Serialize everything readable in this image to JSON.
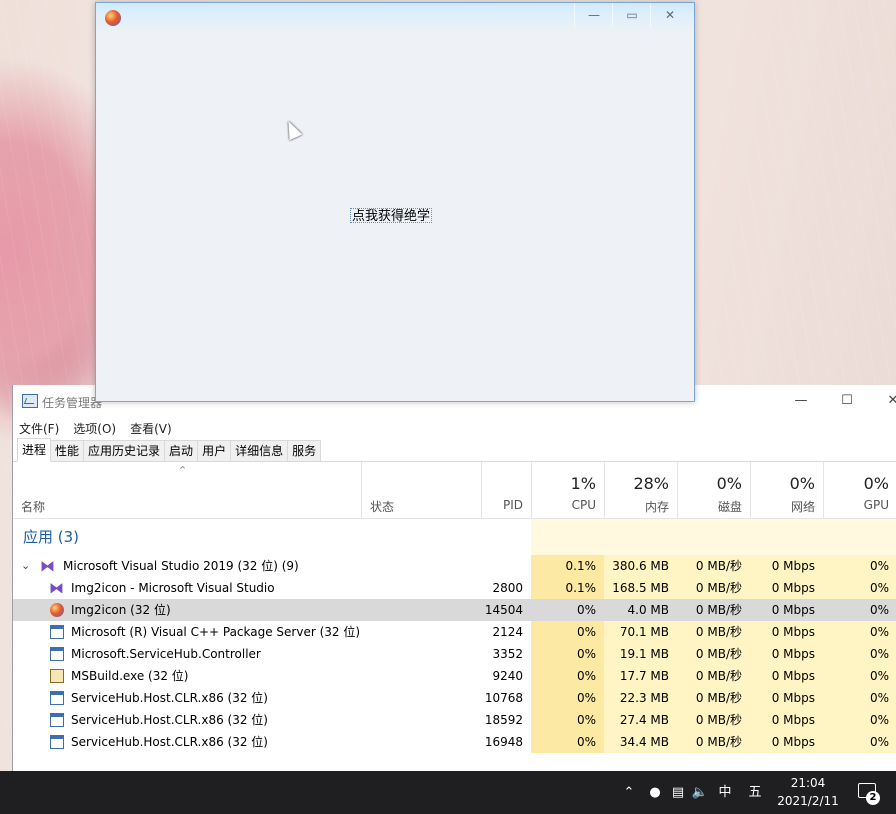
{
  "taskmanager": {
    "title": "任务管理器",
    "menu": [
      "文件(F)",
      "选项(O)",
      "查看(V)"
    ],
    "tabs": [
      "进程",
      "性能",
      "应用历史记录",
      "启动",
      "用户",
      "详细信息",
      "服务"
    ],
    "header": {
      "name": "名称",
      "status": "状态",
      "pid": "PID",
      "cpu_pct": "1%",
      "cpu": "CPU",
      "mem_pct": "28%",
      "mem": "内存",
      "disk_pct": "0%",
      "disk": "磁盘",
      "net_pct": "0%",
      "net": "网络",
      "gpu_pct": "0%",
      "gpu": "GPU"
    },
    "group_label": "应用 (3)",
    "rows": [
      {
        "name": "Microsoft Visual Studio 2019 (32 位) (9)",
        "pid": "",
        "cpu": "0.1%",
        "mem": "380.6 MB",
        "disk": "0 MB/秒",
        "net": "0 Mbps",
        "gpu": "0%"
      },
      {
        "name": "Img2icon - Microsoft Visual Studio",
        "pid": "2800",
        "cpu": "0.1%",
        "mem": "168.5 MB",
        "disk": "0 MB/秒",
        "net": "0 Mbps",
        "gpu": "0%"
      },
      {
        "name": "Img2icon (32 位)",
        "pid": "14504",
        "cpu": "0%",
        "mem": "4.0 MB",
        "disk": "0 MB/秒",
        "net": "0 Mbps",
        "gpu": "0%"
      },
      {
        "name": "Microsoft (R) Visual C++ Package Server (32 位)",
        "pid": "2124",
        "cpu": "0%",
        "mem": "70.1 MB",
        "disk": "0 MB/秒",
        "net": "0 Mbps",
        "gpu": "0%"
      },
      {
        "name": "Microsoft.ServiceHub.Controller",
        "pid": "3352",
        "cpu": "0%",
        "mem": "19.1 MB",
        "disk": "0 MB/秒",
        "net": "0 Mbps",
        "gpu": "0%"
      },
      {
        "name": "MSBuild.exe (32 位)",
        "pid": "9240",
        "cpu": "0%",
        "mem": "17.7 MB",
        "disk": "0 MB/秒",
        "net": "0 Mbps",
        "gpu": "0%"
      },
      {
        "name": "ServiceHub.Host.CLR.x86 (32 位)",
        "pid": "10768",
        "cpu": "0%",
        "mem": "22.3 MB",
        "disk": "0 MB/秒",
        "net": "0 Mbps",
        "gpu": "0%"
      },
      {
        "name": "ServiceHub.Host.CLR.x86 (32 位)",
        "pid": "18592",
        "cpu": "0%",
        "mem": "27.4 MB",
        "disk": "0 MB/秒",
        "net": "0 Mbps",
        "gpu": "0%"
      },
      {
        "name": "ServiceHub.Host.CLR.x86 (32 位)",
        "pid": "16948",
        "cpu": "0%",
        "mem": "34.4 MB",
        "disk": "0 MB/秒",
        "net": "0 Mbps",
        "gpu": "0%"
      }
    ]
  },
  "app_window": {
    "button_label": "点我获得绝学"
  },
  "taskbar": {
    "ime_lang": "中",
    "ime_mode": "五",
    "time": "21:04",
    "date": "2021/2/11",
    "notification_count": "2"
  },
  "colors": {
    "accent": "#1e5fa8",
    "cpu_highlight": "#fce9a3",
    "column_highlight": "#fff4c4",
    "selected_row": "#d9d9d9",
    "taskbar": "#1f1f22"
  }
}
